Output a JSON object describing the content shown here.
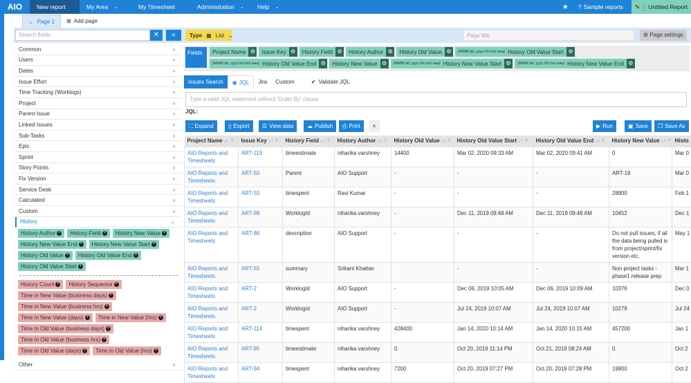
{
  "topbar": {
    "logo": "AIO",
    "nav": [
      "New report",
      "My Area",
      "My Timesheet",
      "Administration",
      "Help"
    ],
    "sample": "Sample reports",
    "report": "Untitled Report"
  },
  "tabs": {
    "page": "Page 1",
    "add": "Add page"
  },
  "left": {
    "search_placeholder": "Search fields",
    "categories": [
      "Common",
      "Users",
      "Dates",
      "Issue Effort",
      "Time Tracking (Worklogs)",
      "Project",
      "Parent Issue",
      "Linked Issues",
      "Sub-Tasks",
      "Epic",
      "Sprint",
      "Story Points",
      "Fix Version",
      "Service Desk",
      "Calculated",
      "Custom"
    ],
    "open_category": "History",
    "history_fields": [
      "History Author",
      "History Field",
      "History New Value",
      "History New Value End",
      "History New Value Start",
      "History Old Value",
      "History Old Value End",
      "History Old Value Start"
    ],
    "history_calc": [
      "History Count",
      "History Sequence",
      "Time in New Value (business days)",
      "Time in New Value (business hrs)",
      "Time in New Value (days)",
      "Time in New Value (hrs)",
      "Time in Old Value (business days)",
      "Time in Old Value (business hrs)",
      "Time in Old Value (days)",
      "Time in Old Value (hrs)"
    ],
    "last_category": "Other"
  },
  "type": {
    "label": "Type",
    "value": "List"
  },
  "page_title_placeholder": "Page title",
  "page_settings": "Page settings",
  "fields": {
    "label": "Fields",
    "items": [
      {
        "fmt": "",
        "name": "Project Name"
      },
      {
        "fmt": "",
        "name": "Issue Key"
      },
      {
        "fmt": "",
        "name": "History Field"
      },
      {
        "fmt": "",
        "name": "History Author"
      },
      {
        "fmt": "",
        "name": "History Old Value"
      },
      {
        "fmt": "{MMM dd, yyyy hh:mm aaa}",
        "name": "History Old Value Start"
      },
      {
        "fmt": "{MMM dd, yyyy hh:mm aaa}",
        "name": "History Old Value End"
      },
      {
        "fmt": "",
        "name": "History New Value"
      },
      {
        "fmt": "{MMM dd, yyyy hh:mm aaa}",
        "name": "History New Value Start"
      },
      {
        "fmt": "{MMM dd, yyyy hh:mm aaa}",
        "name": "History New Value End"
      }
    ]
  },
  "query": {
    "tabs": [
      "Issues Search",
      "JQL",
      "Jira",
      "Custom"
    ],
    "validate": "Validate JQL",
    "placeholder": "Type a valid JQL statement without 'Order By' clause",
    "jql_label": "JQL:"
  },
  "toolbar": {
    "expand": "Expand",
    "export": "Export",
    "view_data": "View data",
    "publish": "Publish",
    "print": "Print",
    "close": "×",
    "run": "Run",
    "save": "Save",
    "save_as": "Save As"
  },
  "table": {
    "columns": [
      "Project Name",
      "Issue Key",
      "History Field",
      "History Author",
      "History Old Value",
      "History Old Value Start",
      "History Old Value End",
      "History New Value",
      "Histo"
    ],
    "rows": [
      [
        "AIO Reports and Timesheets",
        "ART-119",
        "timeestimate",
        "niharika varshney",
        "14400",
        "Mar 02, 2020 09:33 AM",
        "Mar 02, 2020 09:41 AM",
        "0",
        "Mar 0"
      ],
      [
        "AIO Reports and Timesheets",
        "ART-50",
        "Parent",
        "AIO Support",
        "-",
        "-",
        "-",
        "ART-19",
        "Mar 0"
      ],
      [
        "AIO Reports and Timesheets",
        "ART-55",
        "timespent",
        "Ravi Kumar",
        "-",
        "-",
        "-",
        "28800",
        "Feb 1"
      ],
      [
        "AIO Reports and Timesheets",
        "ART-98",
        "WorklogId",
        "niharika varshney",
        "-",
        "Dec 11, 2019 09:48 AM",
        "Dec 11, 2019 09:48 AM",
        "10452",
        "Dec 1"
      ],
      [
        "AIO Reports and Timesheets",
        "ART-86",
        "description",
        "AIO Support",
        "-",
        "-",
        "-",
        "Do not pull issues, if all the data being pulled is from project/sprint/fix version etc.",
        "May 1"
      ],
      [
        "AIO Reports and Timesheets",
        "ART-55",
        "summary",
        "Srikant Khaitan",
        "",
        "-",
        "-",
        "Non project tasks - phase1 release prep",
        "Mar 1"
      ],
      [
        "AIO Reports and Timesheets",
        "ART-2",
        "WorklogId",
        "AIO Support",
        "-",
        "Dec 06, 2019 10:05 AM",
        "Dec 06, 2019 10:09 AM",
        "10376",
        "Dec 0"
      ],
      [
        "AIO Reports and Timesheets",
        "ART-2",
        "WorklogId",
        "AIO Support",
        "-",
        "Jul 24, 2019 10:07 AM",
        "Jul 24, 2019 10:07 AM",
        "10279",
        "Jul 24"
      ],
      [
        "AIO Reports and Timesheets",
        "ART-114",
        "timespent",
        "niharika varshney",
        "428400",
        "Jan 14, 2020 10:14 AM",
        "Jan 14, 2020 10:15 AM",
        "457200",
        "Jan 1"
      ],
      [
        "AIO Reports and Timesheets",
        "ART-95",
        "timeestimate",
        "niharika varshney",
        "0",
        "Oct 20, 2019 11:14 PM",
        "Oct 21, 2019 08:24 AM",
        "0",
        "Oct 2"
      ],
      [
        "AIO Reports and Timesheets",
        "ART-94",
        "timespent",
        "niharika varshney",
        "7200",
        "Oct 20, 2019 07:27 PM",
        "Oct 20, 2019 07:28 PM",
        "19800",
        "Oct 2"
      ]
    ]
  }
}
